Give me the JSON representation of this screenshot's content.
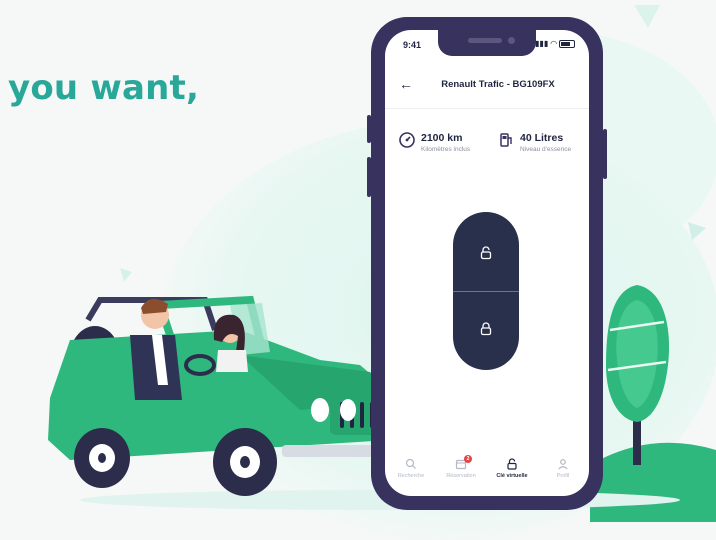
{
  "headline": "you want,",
  "phone": {
    "status_time": "9:41",
    "title": "Renault Trafic - BG109FX",
    "back_label": "←",
    "stats": [
      {
        "value": "2100 km",
        "label": "Kilomètres inclus",
        "icon": "speedometer-icon"
      },
      {
        "value": "40 Litres",
        "label": "Niveau d'essence",
        "icon": "fuel-pump-icon"
      }
    ],
    "key": {
      "unlock_icon": "unlock-icon",
      "lock_icon": "lock-icon"
    },
    "tabs": [
      {
        "label": "Recherche",
        "icon": "search-icon",
        "active": false
      },
      {
        "label": "Réservation",
        "icon": "calendar-icon",
        "active": false,
        "badge": "2"
      },
      {
        "label": "Clé virtuelle",
        "icon": "lock-icon",
        "active": true
      },
      {
        "label": "Profil",
        "icon": "user-icon",
        "active": false
      }
    ]
  },
  "colors": {
    "brand_teal": "#29a89a",
    "phone_frame": "#37325e",
    "key_pill": "#28304b",
    "car_green": "#2fb87e",
    "badge_red": "#e04848"
  }
}
